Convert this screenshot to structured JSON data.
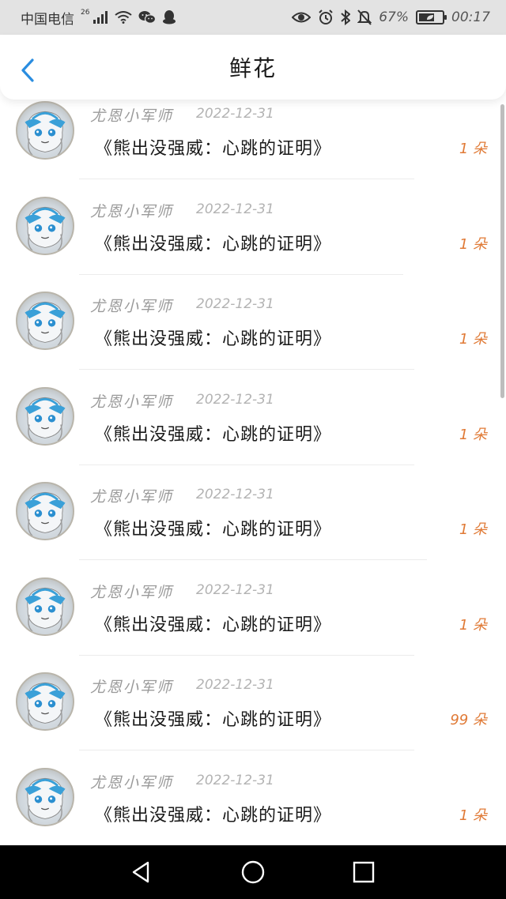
{
  "status_bar": {
    "carrier": "中国电信",
    "network": "26",
    "battery_percent": "67%",
    "battery_level": 0.67,
    "time": "00:17",
    "icons": [
      "signal-icon",
      "wifi-icon",
      "wechat-icon",
      "qq-icon",
      "eye-icon",
      "alarm-icon",
      "bluetooth-icon",
      "mute-icon",
      "battery-icon"
    ]
  },
  "header": {
    "title": "鲜花",
    "back_icon": "chevron-left-icon",
    "accent": "#2a8de0"
  },
  "items": [
    {
      "user": "尤恩小军师",
      "date": "2022-12-31",
      "work": "《熊出没强威：心跳的证明》",
      "count": "1 朵"
    },
    {
      "user": "尤恩小军师",
      "date": "2022-12-31",
      "work": "《熊出没强威：心跳的证明》",
      "count": "1 朵"
    },
    {
      "user": "尤恩小军师",
      "date": "2022-12-31",
      "work": "《熊出没强威：心跳的证明》",
      "count": "1 朵"
    },
    {
      "user": "尤恩小军师",
      "date": "2022-12-31",
      "work": "《熊出没强威：心跳的证明》",
      "count": "1 朵"
    },
    {
      "user": "尤恩小军师",
      "date": "2022-12-31",
      "work": "《熊出没强威：心跳的证明》",
      "count": "1 朵"
    },
    {
      "user": "尤恩小军师",
      "date": "2022-12-31",
      "work": "《熊出没强威：心跳的证明》",
      "count": "1 朵"
    },
    {
      "user": "尤恩小军师",
      "date": "2022-12-31",
      "work": "《熊出没强威：心跳的证明》",
      "count": "99 朵"
    },
    {
      "user": "尤恩小军师",
      "date": "2022-12-31",
      "work": "《熊出没强威：心跳的证明》",
      "count": "1 朵"
    }
  ],
  "count_color": "#e07a36",
  "nav_bar": {
    "icons": [
      "back-triangle-icon",
      "home-circle-icon",
      "recents-square-icon"
    ]
  }
}
